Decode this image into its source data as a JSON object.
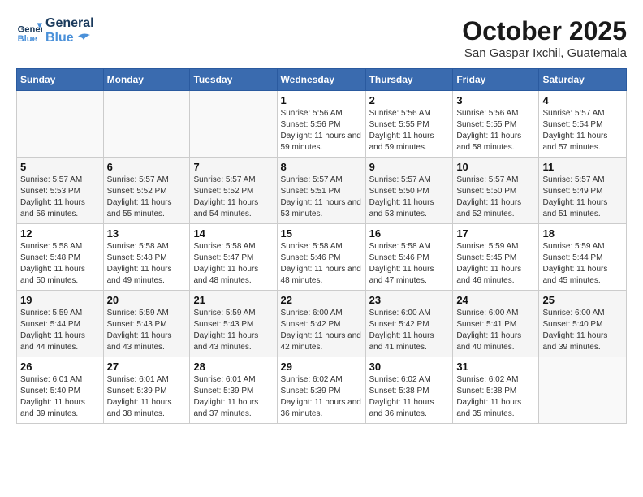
{
  "header": {
    "logo_line1": "General",
    "logo_line2": "Blue",
    "month": "October 2025",
    "location": "San Gaspar Ixchil, Guatemala"
  },
  "weekdays": [
    "Sunday",
    "Monday",
    "Tuesday",
    "Wednesday",
    "Thursday",
    "Friday",
    "Saturday"
  ],
  "weeks": [
    [
      {
        "day": "",
        "info": ""
      },
      {
        "day": "",
        "info": ""
      },
      {
        "day": "",
        "info": ""
      },
      {
        "day": "1",
        "info": "Sunrise: 5:56 AM\nSunset: 5:56 PM\nDaylight: 11 hours and 59 minutes."
      },
      {
        "day": "2",
        "info": "Sunrise: 5:56 AM\nSunset: 5:55 PM\nDaylight: 11 hours and 59 minutes."
      },
      {
        "day": "3",
        "info": "Sunrise: 5:56 AM\nSunset: 5:55 PM\nDaylight: 11 hours and 58 minutes."
      },
      {
        "day": "4",
        "info": "Sunrise: 5:57 AM\nSunset: 5:54 PM\nDaylight: 11 hours and 57 minutes."
      }
    ],
    [
      {
        "day": "5",
        "info": "Sunrise: 5:57 AM\nSunset: 5:53 PM\nDaylight: 11 hours and 56 minutes."
      },
      {
        "day": "6",
        "info": "Sunrise: 5:57 AM\nSunset: 5:52 PM\nDaylight: 11 hours and 55 minutes."
      },
      {
        "day": "7",
        "info": "Sunrise: 5:57 AM\nSunset: 5:52 PM\nDaylight: 11 hours and 54 minutes."
      },
      {
        "day": "8",
        "info": "Sunrise: 5:57 AM\nSunset: 5:51 PM\nDaylight: 11 hours and 53 minutes."
      },
      {
        "day": "9",
        "info": "Sunrise: 5:57 AM\nSunset: 5:50 PM\nDaylight: 11 hours and 53 minutes."
      },
      {
        "day": "10",
        "info": "Sunrise: 5:57 AM\nSunset: 5:50 PM\nDaylight: 11 hours and 52 minutes."
      },
      {
        "day": "11",
        "info": "Sunrise: 5:57 AM\nSunset: 5:49 PM\nDaylight: 11 hours and 51 minutes."
      }
    ],
    [
      {
        "day": "12",
        "info": "Sunrise: 5:58 AM\nSunset: 5:48 PM\nDaylight: 11 hours and 50 minutes."
      },
      {
        "day": "13",
        "info": "Sunrise: 5:58 AM\nSunset: 5:48 PM\nDaylight: 11 hours and 49 minutes."
      },
      {
        "day": "14",
        "info": "Sunrise: 5:58 AM\nSunset: 5:47 PM\nDaylight: 11 hours and 48 minutes."
      },
      {
        "day": "15",
        "info": "Sunrise: 5:58 AM\nSunset: 5:46 PM\nDaylight: 11 hours and 48 minutes."
      },
      {
        "day": "16",
        "info": "Sunrise: 5:58 AM\nSunset: 5:46 PM\nDaylight: 11 hours and 47 minutes."
      },
      {
        "day": "17",
        "info": "Sunrise: 5:59 AM\nSunset: 5:45 PM\nDaylight: 11 hours and 46 minutes."
      },
      {
        "day": "18",
        "info": "Sunrise: 5:59 AM\nSunset: 5:44 PM\nDaylight: 11 hours and 45 minutes."
      }
    ],
    [
      {
        "day": "19",
        "info": "Sunrise: 5:59 AM\nSunset: 5:44 PM\nDaylight: 11 hours and 44 minutes."
      },
      {
        "day": "20",
        "info": "Sunrise: 5:59 AM\nSunset: 5:43 PM\nDaylight: 11 hours and 43 minutes."
      },
      {
        "day": "21",
        "info": "Sunrise: 5:59 AM\nSunset: 5:43 PM\nDaylight: 11 hours and 43 minutes."
      },
      {
        "day": "22",
        "info": "Sunrise: 6:00 AM\nSunset: 5:42 PM\nDaylight: 11 hours and 42 minutes."
      },
      {
        "day": "23",
        "info": "Sunrise: 6:00 AM\nSunset: 5:42 PM\nDaylight: 11 hours and 41 minutes."
      },
      {
        "day": "24",
        "info": "Sunrise: 6:00 AM\nSunset: 5:41 PM\nDaylight: 11 hours and 40 minutes."
      },
      {
        "day": "25",
        "info": "Sunrise: 6:00 AM\nSunset: 5:40 PM\nDaylight: 11 hours and 39 minutes."
      }
    ],
    [
      {
        "day": "26",
        "info": "Sunrise: 6:01 AM\nSunset: 5:40 PM\nDaylight: 11 hours and 39 minutes."
      },
      {
        "day": "27",
        "info": "Sunrise: 6:01 AM\nSunset: 5:39 PM\nDaylight: 11 hours and 38 minutes."
      },
      {
        "day": "28",
        "info": "Sunrise: 6:01 AM\nSunset: 5:39 PM\nDaylight: 11 hours and 37 minutes."
      },
      {
        "day": "29",
        "info": "Sunrise: 6:02 AM\nSunset: 5:39 PM\nDaylight: 11 hours and 36 minutes."
      },
      {
        "day": "30",
        "info": "Sunrise: 6:02 AM\nSunset: 5:38 PM\nDaylight: 11 hours and 36 minutes."
      },
      {
        "day": "31",
        "info": "Sunrise: 6:02 AM\nSunset: 5:38 PM\nDaylight: 11 hours and 35 minutes."
      },
      {
        "day": "",
        "info": ""
      }
    ]
  ]
}
